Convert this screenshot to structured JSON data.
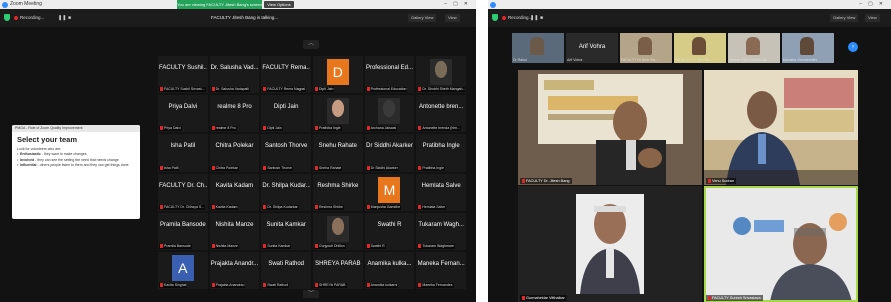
{
  "left": {
    "window_title": "Zoom Meeting",
    "view_banner": "You are viewing FACULTY Jitesh Bang's screen",
    "view_options": "View Options",
    "recording": "Recording...",
    "speaker": "FACULTY Jitesh Bang is talking...",
    "layout_button": "Gallery View",
    "view_button": "View",
    "panel": {
      "header": "PMGA - Role of Zoom Quality Improvement",
      "title": "Select your team",
      "intro": "Look for volunteers who are:",
      "bullets": [
        {
          "bold": "Enthusiastic",
          "text": " - they want to make changes"
        },
        {
          "bold": "Involved",
          "text": " - they can see the setting the need that needs change"
        },
        {
          "bold": "Influential",
          "text": " - others people listen to them and they can get things done"
        }
      ]
    },
    "tiles": [
      {
        "name": "FACULTY Sushil...",
        "label": "FACULTY Sushil Srivast..."
      },
      {
        "name": "Dr. Salusha Vad...",
        "label": "Dr. Salusha Vadapalli"
      },
      {
        "name": "FACULTY Rema...",
        "label": "FACULTY Rema Nagpal"
      },
      {
        "avatar": "D",
        "avatar_color": "#e8761c",
        "label": "Dipti Jain"
      },
      {
        "name": "Professional Ed...",
        "label": "Professional Education"
      },
      {
        "photo": "#7a6a58",
        "label": "Dr. Shobhi Sheth Mangab..."
      },
      {
        "name": "Priya Dalvi",
        "label": "Priya Dalvi"
      },
      {
        "name": "realme 8 Pro",
        "label": "realme 8 Pro"
      },
      {
        "name": "Dipti Jain",
        "label": "Dipti Jain"
      },
      {
        "photo": "#c79a82",
        "label": "Prathiba Ingle"
      },
      {
        "photo": "#3a3a3a",
        "label": "Archana Jaiswal"
      },
      {
        "name": "Antonette bren...",
        "label": "Antonette brenda (him..."
      },
      {
        "name": "Isha Patil",
        "label": "Isha Patil"
      },
      {
        "name": "Chitra Polekar",
        "label": "Chitra Polekar"
      },
      {
        "name": "Santosh Thorve",
        "label": "Santosh Thorve"
      },
      {
        "name": "Snehu Rahate",
        "label": "Sneha Rahate"
      },
      {
        "name": "Dr Siddhi Akarker",
        "label": "Dr Siddhi Akarker"
      },
      {
        "name": "Pratibha Ingle",
        "label": "Pratibha Ingle"
      },
      {
        "name": "FACULTY Dr. Ch...",
        "label": "FACULTY Dr. Chhaya S..."
      },
      {
        "name": "Kavita Kadam",
        "label": "Kavita Kadam"
      },
      {
        "name": "Dr. Shilpa Kudar...",
        "label": "Dr. Shilpa Kudarkar"
      },
      {
        "name": "Reshma Shirke",
        "label": "Reshma Shirke"
      },
      {
        "avatar": "M",
        "avatar_color": "#e8761c",
        "label": "Manjusha Gamdhe"
      },
      {
        "name": "Hemlata Salve",
        "label": "Hemlata Salve"
      },
      {
        "name": "Pramila Bansode",
        "label": "Pramila Bansode"
      },
      {
        "name": "Nishita Manze",
        "label": "Nishita Manze"
      },
      {
        "name": "Sunita Kamkar",
        "label": "Sunita Kamkar"
      },
      {
        "photo": "#8a6f5a",
        "label": "Gurjyouti Dhillon"
      },
      {
        "name": "Swathi R",
        "label": "Swathi R"
      },
      {
        "name": "Tukaram Wagh...",
        "label": "Tukaram Waghmare"
      },
      {
        "avatar": "A",
        "avatar_color": "#3b5fb0",
        "label": "Kavita Singhal"
      },
      {
        "name": "Prajakta Anandr...",
        "label": "Prajakta Anandrao"
      },
      {
        "name": "Swati Rathod",
        "label": "Swati Rathod"
      },
      {
        "name": "SHREYA PARAB",
        "label": "SHREYA PARAB"
      },
      {
        "name": "Anamika kulka...",
        "label": "Anamika kulkarni"
      },
      {
        "name": "Maneka Fernan...",
        "label": "Maneka Fernandes"
      }
    ]
  },
  "right": {
    "recording": "Recording...",
    "layout_button": "Gallery View",
    "view_button": "View",
    "strip": [
      {
        "label": "Dr Rahul",
        "face": "#6b5a4a",
        "bg": "#5a6a7a"
      },
      {
        "name": "Arif Vohra",
        "label": "Arif Vohra"
      },
      {
        "label": "FACULTY Dr Arun Ga...",
        "face": "#7a5e48",
        "bg": "#b4a58a"
      },
      {
        "label": "FACULTY Dr. Shiv Gu...",
        "face": "#6a4e38",
        "bg": "#d6cc88"
      },
      {
        "label": "Naresh Pillai Jemmu Ka...",
        "face": "#8a6a55",
        "bg": "#c7c2b8"
      },
      {
        "label": "Manisha Gumnemdev",
        "face": "#5f4a3a",
        "bg": "#8fa0b5"
      }
    ],
    "big": [
      {
        "label": "FACULTY Dr. Jitesh Bang"
      },
      {
        "label": "Venu Sudran"
      },
      {
        "label": "Gurmaheklar Vitthalkar"
      },
      {
        "label": "FACULTY Suresh Srivastava"
      }
    ]
  }
}
